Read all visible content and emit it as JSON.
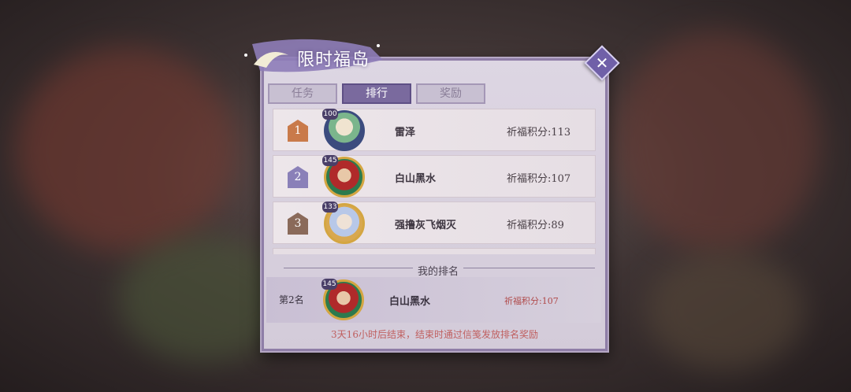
{
  "window": {
    "title": "限时福岛",
    "close_icon": "close-icon"
  },
  "tabs": [
    {
      "label": "任务",
      "active": false
    },
    {
      "label": "排行",
      "active": true
    },
    {
      "label": "奖励",
      "active": false
    }
  ],
  "ranking": [
    {
      "rank": "1",
      "level": "100",
      "name": "雷泽",
      "score": "祈福积分:113",
      "badge_color": "#c97a4a"
    },
    {
      "rank": "2",
      "level": "145",
      "name": "白山黑水",
      "score": "祈福积分:107",
      "badge_color": "#8a80b8"
    },
    {
      "rank": "3",
      "level": "133",
      "name": "强撸灰飞烟灭",
      "score": "祈福积分:89",
      "badge_color": "#8a6a5a"
    }
  ],
  "my_rank": {
    "divider_label": "我的排名",
    "rank_label": "第2名",
    "level": "145",
    "name": "白山黑水",
    "score": "祈福积分:107"
  },
  "footer": {
    "note": "3天16小时后结束，结束时通过信笺发放排名奖励"
  }
}
